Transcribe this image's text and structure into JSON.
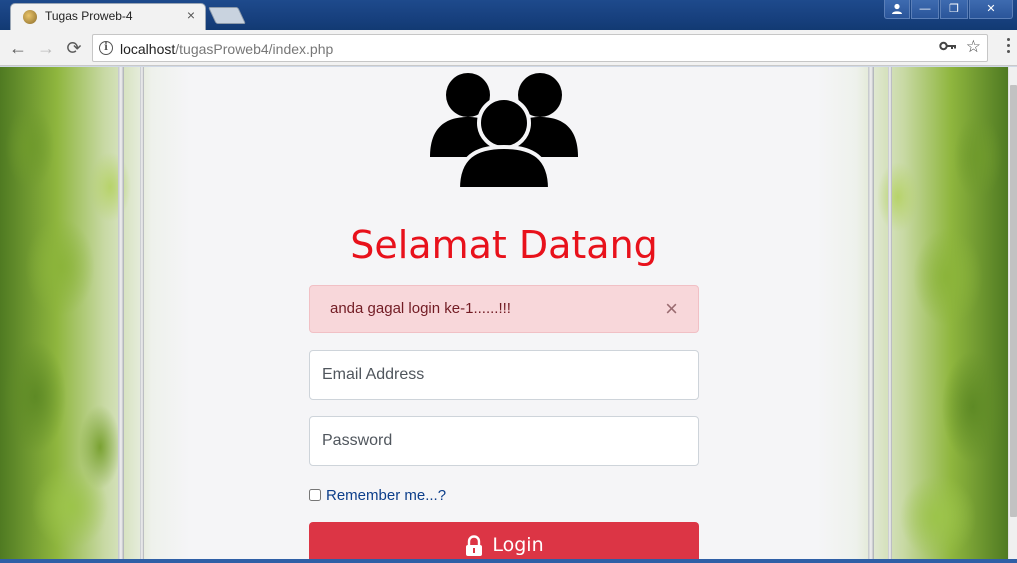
{
  "browser": {
    "tab_title": "Tugas Proweb-4",
    "tab_close": "×",
    "url_host": "localhost",
    "url_path": "/tugasProweb4/index.php",
    "back": "←",
    "forward": "→",
    "reload": "⟳",
    "window_minimize": "—",
    "window_restore": "❐",
    "window_close": "✕"
  },
  "page": {
    "heading": "Selamat Datang",
    "alert": {
      "message": "anda gagal login ke-1......!!!",
      "close": "×"
    },
    "email_placeholder": "Email Address",
    "password_placeholder": "Password",
    "remember_label": "Remember me...?",
    "login_label": "Login"
  },
  "colors": {
    "heading": "#e8111b",
    "alert_bg": "#f8d7da",
    "button": "#dc3545"
  },
  "icons": [
    "info-icon",
    "key-icon",
    "star-icon",
    "users-icon",
    "lock-icon"
  ]
}
